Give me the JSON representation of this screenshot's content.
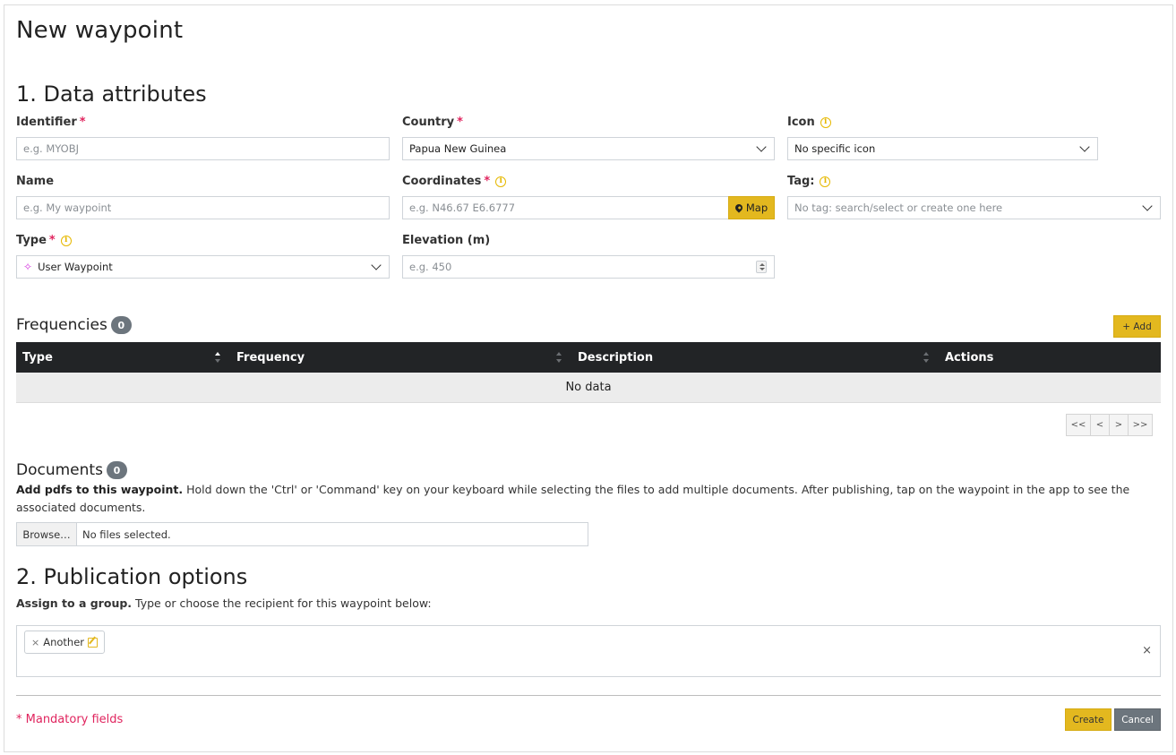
{
  "page": {
    "title": "New waypoint"
  },
  "section1": {
    "title": "1. Data attributes",
    "required_marker": "*",
    "identifier": {
      "label": "Identifier",
      "placeholder": "e.g. MYOBJ"
    },
    "country": {
      "label": "Country",
      "value": "Papua New Guinea"
    },
    "icon": {
      "label": "Icon",
      "value": "No specific icon"
    },
    "name": {
      "label": "Name",
      "placeholder": "e.g. My waypoint"
    },
    "coordinates": {
      "label": "Coordinates",
      "placeholder": "e.g. N46.67 E6.6777",
      "map_button": "Map"
    },
    "tag": {
      "label": "Tag:",
      "placeholder": "No tag: search/select or create one here"
    },
    "type": {
      "label": "Type",
      "value": "User Waypoint",
      "icon_glyph": "✧"
    },
    "elevation": {
      "label": "Elevation (m)",
      "placeholder": "e.g. 450"
    },
    "info_glyph": "i"
  },
  "frequencies": {
    "title": "Frequencies",
    "count": "0",
    "add_button": "+ Add",
    "columns": [
      "Type",
      "Frequency",
      "Description",
      "Actions"
    ],
    "empty_text": "No data",
    "pager": [
      "<<",
      "<",
      ">",
      ">>"
    ]
  },
  "documents": {
    "title": "Documents",
    "count": "0",
    "intro_bold": "Add pdfs to this waypoint.",
    "intro_text": " Hold down the 'Ctrl' or 'Command' key on your keyboard while selecting the files to add multiple documents. After publishing, tap on the waypoint in the app to see the associated documents.",
    "browse_label": "Browse…",
    "file_status": "No files selected."
  },
  "section2": {
    "title": "2. Publication options",
    "assign_bold": "Assign to a group.",
    "assign_text": " Type or choose the recipient for this waypoint below:",
    "recipient_chip": "Another",
    "chip_remove": "×",
    "clear_glyph": "×"
  },
  "footer": {
    "mandatory_note": "* Mandatory fields",
    "create_button": "Create",
    "cancel_button": "Cancel"
  },
  "colors": {
    "accent": "#e3b81f",
    "required": "#e0245e",
    "table_header": "#222426",
    "badge": "#6c757d",
    "type_icon": "#d63be0"
  }
}
